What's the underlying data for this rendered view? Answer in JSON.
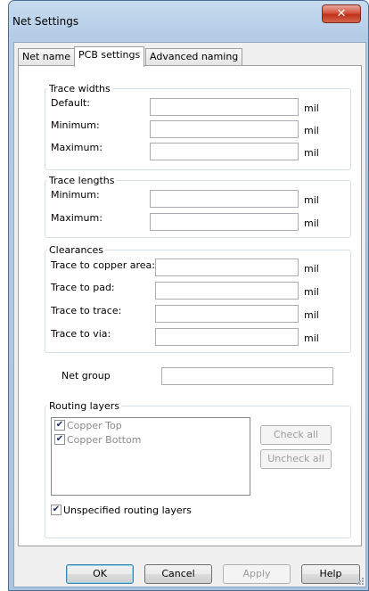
{
  "window": {
    "title": "Net Settings",
    "close_glyph": "✕"
  },
  "tabs": [
    {
      "label": "Net name",
      "active": false
    },
    {
      "label": "PCB settings",
      "active": true
    },
    {
      "label": "Advanced naming",
      "active": false
    }
  ],
  "unit": "mil",
  "trace_widths": {
    "title": "Trace widths",
    "default_label": "Default:",
    "default_value": "",
    "minimum_label": "Minimum:",
    "minimum_value": "",
    "maximum_label": "Maximum:",
    "maximum_value": ""
  },
  "trace_lengths": {
    "title": "Trace lengths",
    "minimum_label": "Minimum:",
    "minimum_value": "",
    "maximum_label": "Maximum:",
    "maximum_value": ""
  },
  "clearances": {
    "title": "Clearances",
    "copper_area_label": "Trace to copper area:",
    "copper_area_value": "",
    "pad_label": "Trace to pad:",
    "pad_value": "",
    "trace_label": "Trace to trace:",
    "trace_value": "",
    "via_label": "Trace to via:",
    "via_value": ""
  },
  "net_group": {
    "label": "Net group",
    "value": ""
  },
  "routing_layers": {
    "title": "Routing layers",
    "items": [
      {
        "label": "Copper Top",
        "checked": true
      },
      {
        "label": "Copper Bottom",
        "checked": true
      }
    ],
    "check_all": "Check all",
    "uncheck_all": "Uncheck all",
    "unspecified_label": "Unspecified routing layers",
    "unspecified_checked": true
  },
  "buttons": {
    "ok": "OK",
    "cancel": "Cancel",
    "apply": "Apply",
    "help": "Help"
  },
  "colors": {
    "title_bar": "#b4cce6",
    "close_button": "#c0301a",
    "group_border": "#d5dfe5"
  }
}
